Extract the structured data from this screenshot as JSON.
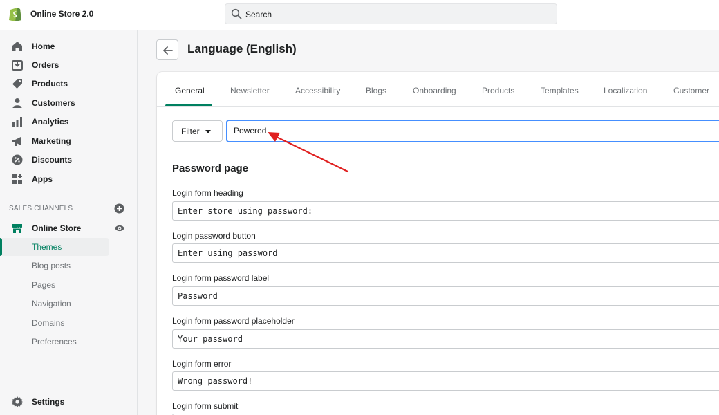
{
  "app": {
    "store_name": "Online Store 2.0",
    "search_placeholder": "Search"
  },
  "sidebar": {
    "items": [
      {
        "label": "Home",
        "icon": "home-icon"
      },
      {
        "label": "Orders",
        "icon": "orders-icon"
      },
      {
        "label": "Products",
        "icon": "tag-icon"
      },
      {
        "label": "Customers",
        "icon": "person-icon"
      },
      {
        "label": "Analytics",
        "icon": "bar-chart-icon"
      },
      {
        "label": "Marketing",
        "icon": "megaphone-icon"
      },
      {
        "label": "Discounts",
        "icon": "discount-icon"
      },
      {
        "label": "Apps",
        "icon": "apps-icon"
      }
    ],
    "sales_channels_title": "SALES CHANNELS",
    "online_store_label": "Online Store",
    "sub_items": [
      "Themes",
      "Blog posts",
      "Pages",
      "Navigation",
      "Domains",
      "Preferences"
    ],
    "active_sub_item": "Themes",
    "settings_label": "Settings"
  },
  "page": {
    "title": "Language (English)"
  },
  "tabs": [
    "General",
    "Newsletter",
    "Accessibility",
    "Blogs",
    "Onboarding",
    "Products",
    "Templates",
    "Localization",
    "Customer"
  ],
  "active_tab": "General",
  "filter": {
    "button_label": "Filter",
    "value": "Powered"
  },
  "section": {
    "heading": "Password page",
    "fields": [
      {
        "label": "Login form heading",
        "value": "Enter store using password:"
      },
      {
        "label": "Login password button",
        "value": "Enter using password"
      },
      {
        "label": "Login form password label",
        "value": "Password"
      },
      {
        "label": "Login form password placeholder",
        "value": "Your password"
      },
      {
        "label": "Login form error",
        "value": "Wrong password!"
      },
      {
        "label": "Login form submit",
        "value": ""
      }
    ]
  },
  "colors": {
    "accent": "#008060",
    "focus": "#458fff",
    "annotation_arrow": "#e02020"
  }
}
